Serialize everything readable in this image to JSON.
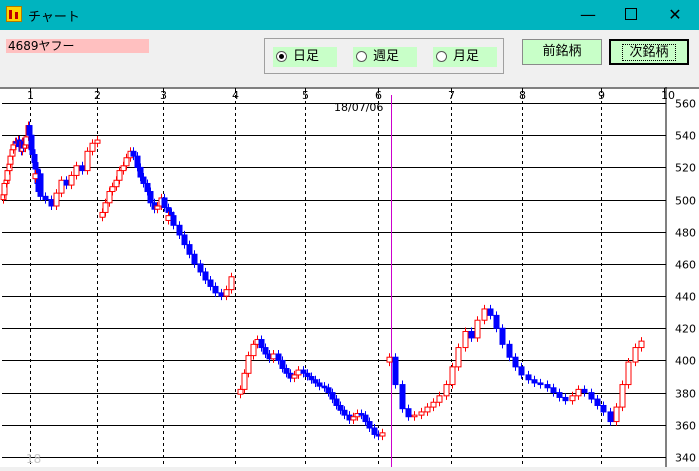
{
  "window": {
    "title": "チャート",
    "app_icon": "chart-app-icon",
    "controls": {
      "minimize": "—",
      "maximize": "□",
      "close": "✕"
    }
  },
  "toolbar": {
    "stock_label": "4689ヤフー",
    "period_options": [
      {
        "label": "日足",
        "selected": true
      },
      {
        "label": "週足",
        "selected": false
      },
      {
        "label": "月足",
        "selected": false
      }
    ],
    "prev_button": "前銘柄",
    "next_button": "次銘柄"
  },
  "chart_data": {
    "type": "candlestick",
    "month_labels": [
      "1",
      "2",
      "3",
      "4",
      "5",
      "6",
      "7",
      "8",
      "9",
      "10"
    ],
    "year_label": "18",
    "cursor_date": "18/07/06",
    "yticks": [
      340,
      360,
      380,
      400,
      420,
      440,
      460,
      480,
      500,
      520,
      540,
      560
    ],
    "ylim": [
      335,
      565
    ],
    "colors": {
      "up": "#ff0000",
      "down": "#0000ff",
      "cursor": "#cc00cc",
      "grid": "#000000"
    },
    "segments": [
      {
        "month": 1,
        "closes": [
          503,
          510,
          512,
          518,
          522,
          527,
          531,
          534,
          536,
          535,
          537,
          533,
          530,
          536,
          532,
          534,
          539,
          546,
          540,
          531,
          528,
          523,
          519,
          510,
          505
        ]
      },
      {
        "month": 2,
        "closes": [
          516,
          502,
          500,
          496,
          504,
          512,
          509,
          515,
          521,
          518,
          530,
          535,
          537
        ]
      },
      {
        "month": 3,
        "closes": [
          492,
          498,
          505,
          508,
          512,
          518,
          521,
          526,
          530,
          527,
          520,
          514,
          510,
          505,
          498,
          494,
          496,
          501,
          495,
          492,
          488
        ]
      },
      {
        "month": 4,
        "closes": [
          490,
          484,
          478,
          472,
          466,
          460,
          455,
          450,
          446,
          442,
          440,
          444,
          452
        ]
      },
      {
        "month": 5,
        "closes": [
          382,
          392,
          403,
          410,
          413,
          408,
          404,
          401,
          404,
          400,
          395,
          392,
          389,
          391,
          394,
          392,
          390,
          388,
          386,
          384,
          383,
          380,
          376,
          372,
          369,
          366,
          363,
          365,
          367,
          366,
          362,
          358,
          354,
          353,
          355
        ]
      },
      {
        "month": 7,
        "closes": [
          402,
          385,
          370,
          365,
          366,
          368,
          371,
          374,
          378,
          385,
          396,
          408,
          418,
          414,
          425,
          432,
          428,
          420,
          410,
          402,
          396,
          391,
          388,
          386,
          385,
          383,
          380,
          377,
          375,
          378,
          382,
          380,
          376,
          372,
          368,
          362,
          371,
          385,
          399,
          408,
          412
        ]
      }
    ]
  }
}
